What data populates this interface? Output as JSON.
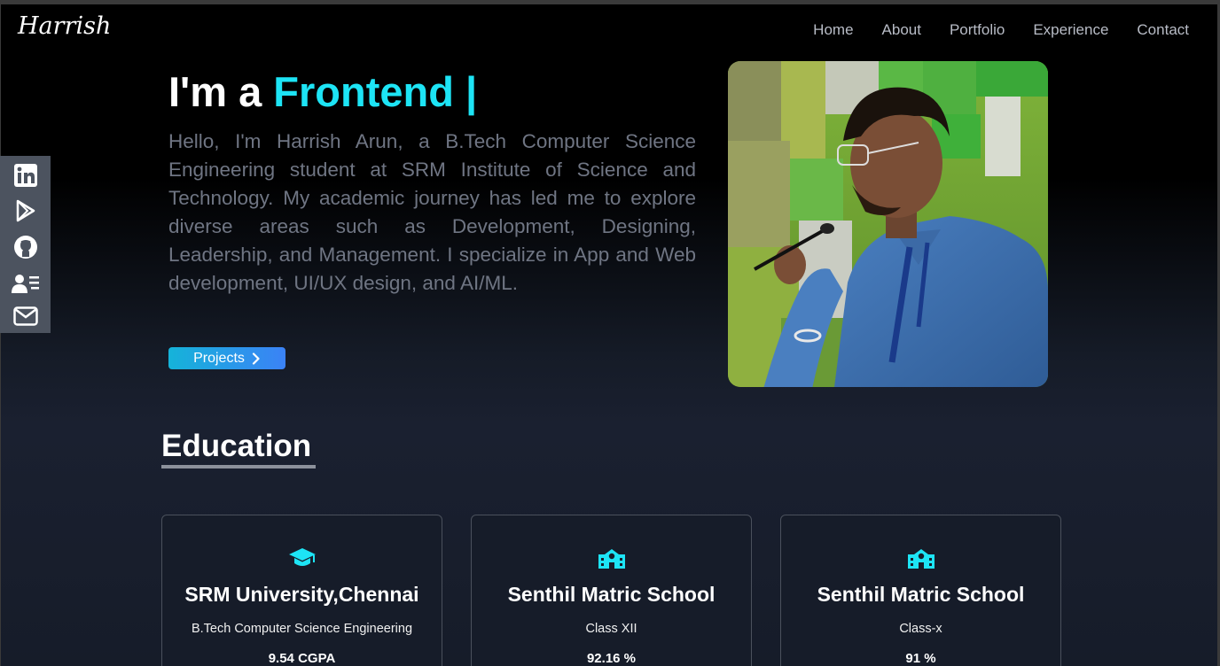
{
  "brand": {
    "logo": "Harrish"
  },
  "nav": {
    "items": [
      "Home",
      "About",
      "Portfolio",
      "Experience",
      "Contact"
    ]
  },
  "hero": {
    "title_prefix": "I'm a ",
    "title_accent": "Frontend |",
    "intro": "Hello, I'm Harrish Arun, a B.Tech Computer Science Engineering student at SRM Institute of Science and Technology. My academic journey has led me to explore diverse areas such as Development, Designing, Leadership, and Management. I specialize in App and Web development, UI/UX design, and AI/ML.",
    "button_label": "Projects"
  },
  "social": {
    "icons": [
      "linkedin-icon",
      "google-play-icon",
      "github-icon",
      "resume-icon",
      "mail-icon"
    ]
  },
  "education": {
    "heading": "Education",
    "cards": [
      {
        "icon": "graduation-cap-icon",
        "title": "SRM University,Chennai",
        "subtitle": "B.Tech Computer Science Engineering",
        "score": "9.54 CGPA"
      },
      {
        "icon": "school-icon",
        "title": "Senthil Matric School",
        "subtitle": "Class XII",
        "score": "92.16 %"
      },
      {
        "icon": "school-icon",
        "title": "Senthil Matric School",
        "subtitle": "Class-x",
        "score": "91 %"
      }
    ]
  },
  "colors": {
    "accent": "#1de4f5",
    "button_start": "#15b3d9",
    "button_end": "#3b82f6",
    "social_bar": "#4c535f"
  }
}
